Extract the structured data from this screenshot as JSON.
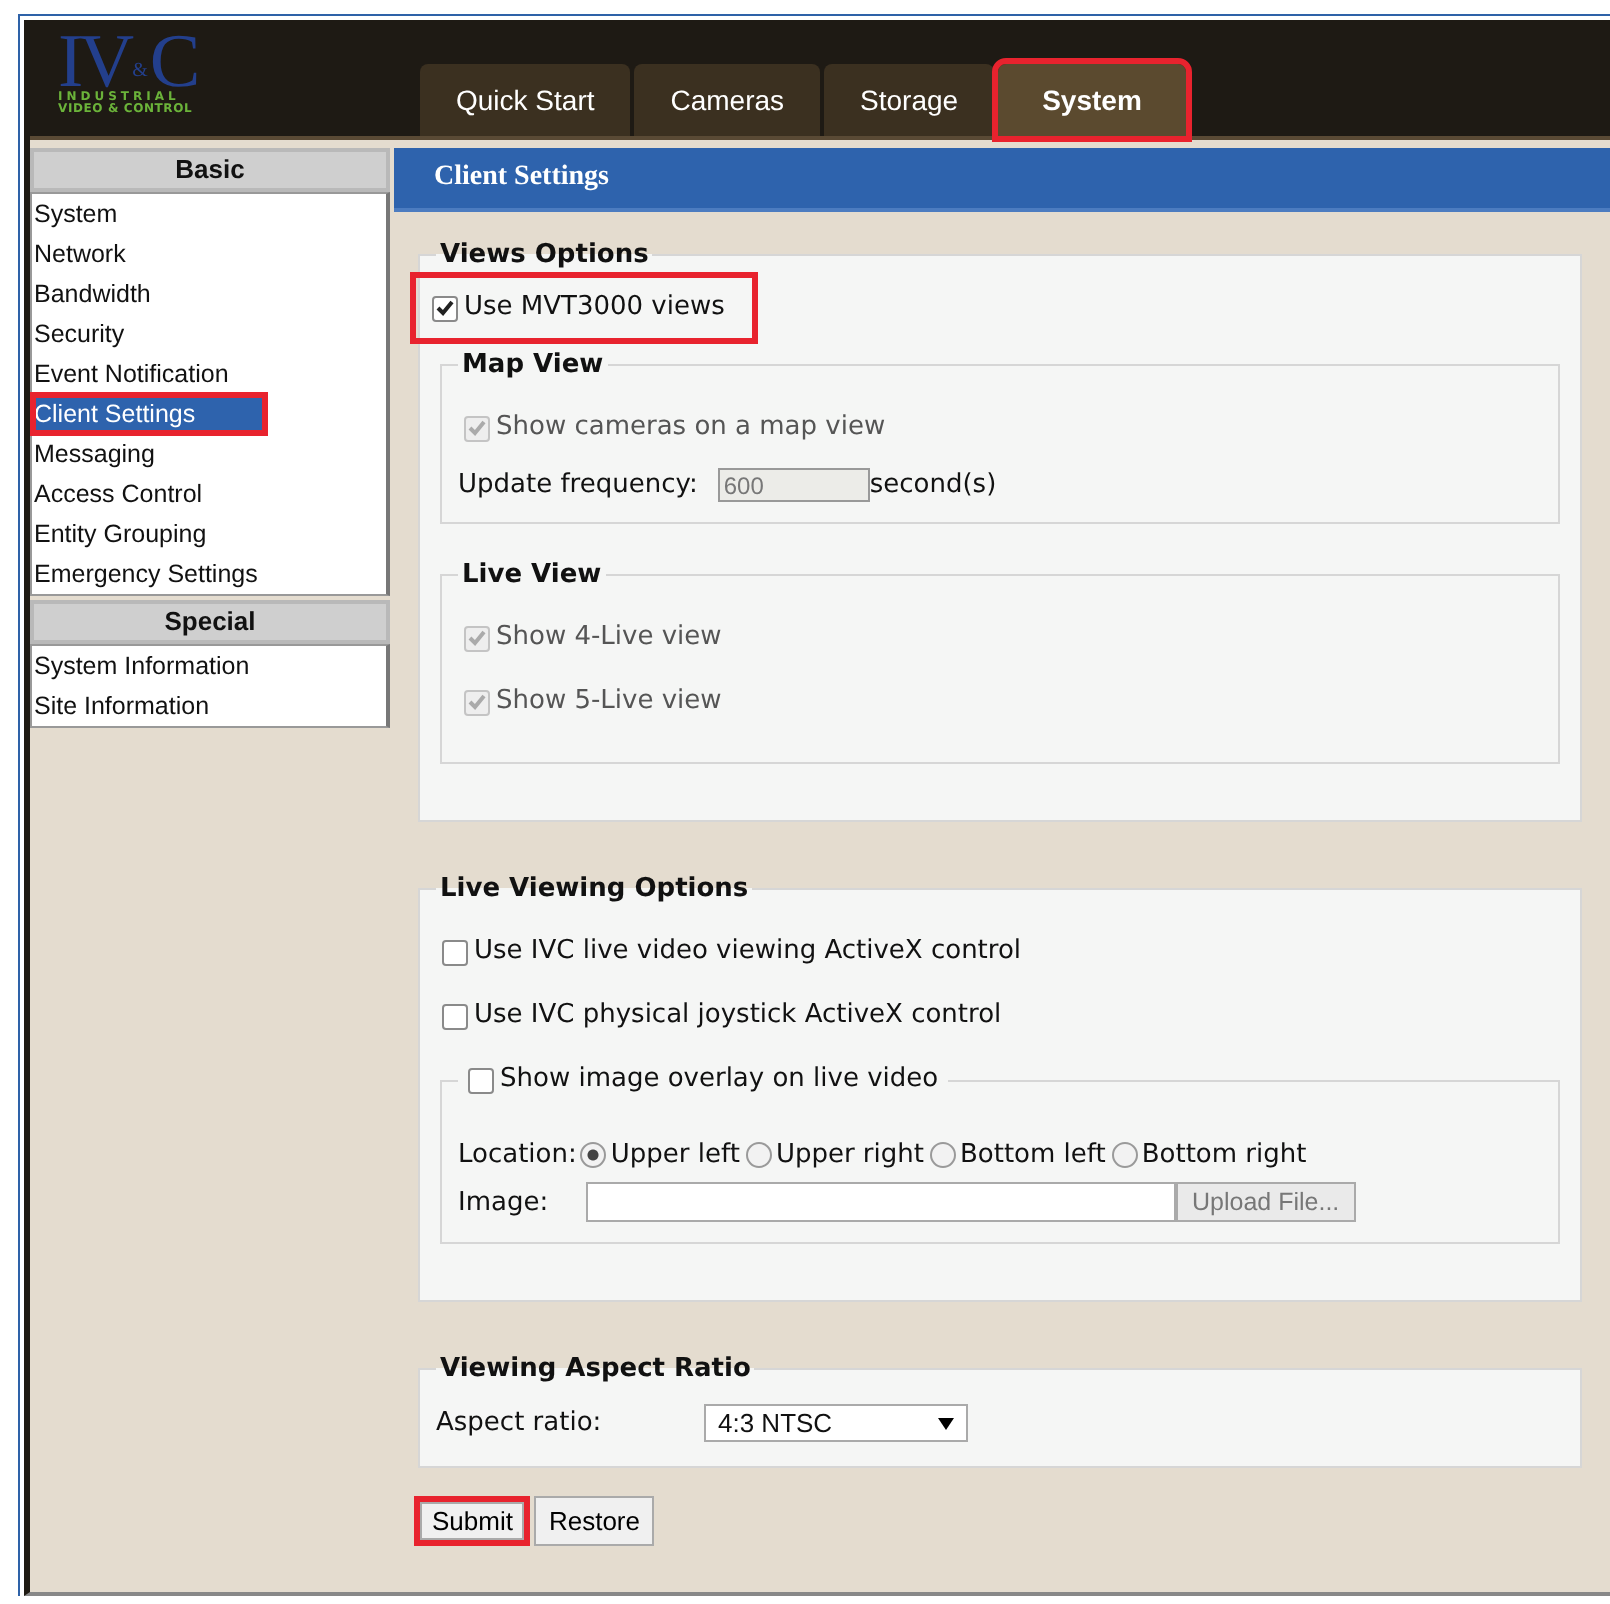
{
  "header": {
    "logo": {
      "mark_left": "IV",
      "mark_amp": "&",
      "mark_right": "C",
      "tagline_1": "INDUSTRIAL",
      "tagline_2": "VIDEO & CONTROL"
    },
    "tabs": [
      {
        "label": "Quick Start",
        "selected": false,
        "highlighted": false
      },
      {
        "label": "Cameras",
        "selected": false,
        "highlighted": false
      },
      {
        "label": "Storage",
        "selected": false,
        "highlighted": false
      },
      {
        "label": "System",
        "selected": true,
        "highlighted": true
      }
    ]
  },
  "sidebar": {
    "sections": [
      {
        "title": "Basic",
        "items": [
          {
            "label": "System",
            "selected": false,
            "highlighted": false
          },
          {
            "label": "Network",
            "selected": false,
            "highlighted": false
          },
          {
            "label": "Bandwidth",
            "selected": false,
            "highlighted": false
          },
          {
            "label": "Security",
            "selected": false,
            "highlighted": false
          },
          {
            "label": "Event Notification",
            "selected": false,
            "highlighted": false
          },
          {
            "label": "Client Settings",
            "selected": true,
            "highlighted": true
          },
          {
            "label": "Messaging",
            "selected": false,
            "highlighted": false
          },
          {
            "label": "Access Control",
            "selected": false,
            "highlighted": false
          },
          {
            "label": "Entity Grouping",
            "selected": false,
            "highlighted": false
          },
          {
            "label": "Emergency Settings",
            "selected": false,
            "highlighted": false
          }
        ]
      },
      {
        "title": "Special",
        "items": [
          {
            "label": "System Information",
            "selected": false,
            "highlighted": false
          },
          {
            "label": "Site Information",
            "selected": false,
            "highlighted": false
          }
        ]
      }
    ]
  },
  "content": {
    "title": "Client Settings",
    "views_options": {
      "legend": "Views Options",
      "use_views": {
        "label": "Use MVT3000 views",
        "checked": true,
        "highlighted": true
      },
      "map_view": {
        "legend": "Map View",
        "show_cameras": {
          "label": "Show cameras on a map view",
          "checked": true,
          "disabled": true
        },
        "frequency": {
          "label": "Update frequency:",
          "value": "600",
          "unit": "second(s)",
          "disabled": true
        }
      },
      "live_view": {
        "legend": "Live View",
        "options": [
          {
            "label": "Show 4-Live view",
            "checked": true,
            "disabled": true
          },
          {
            "label": "Show 5-Live view",
            "checked": true,
            "disabled": true
          }
        ]
      }
    },
    "live_viewing_options": {
      "legend": "Live Viewing Options",
      "options": [
        {
          "label": "Use IVC live video viewing ActiveX control",
          "checked": false,
          "disabled": false
        },
        {
          "label": "Use IVC physical joystick ActiveX control",
          "checked": false,
          "disabled": false
        }
      ],
      "overlay": {
        "label": "Show image overlay on live video",
        "checked": false,
        "location_label": "Location:",
        "locations": [
          {
            "label": "Upper left",
            "selected": true
          },
          {
            "label": "Upper right",
            "selected": false
          },
          {
            "label": "Bottom left",
            "selected": false
          },
          {
            "label": "Bottom right",
            "selected": false
          }
        ],
        "image_label": "Image:",
        "upload_button": "Upload File..."
      }
    },
    "aspect_ratio": {
      "legend": "Viewing Aspect Ratio",
      "label": "Aspect ratio:",
      "value": "4:3 NTSC"
    },
    "buttons": [
      {
        "label": "Submit",
        "highlighted": true
      },
      {
        "label": "Restore",
        "highlighted": false
      }
    ]
  }
}
